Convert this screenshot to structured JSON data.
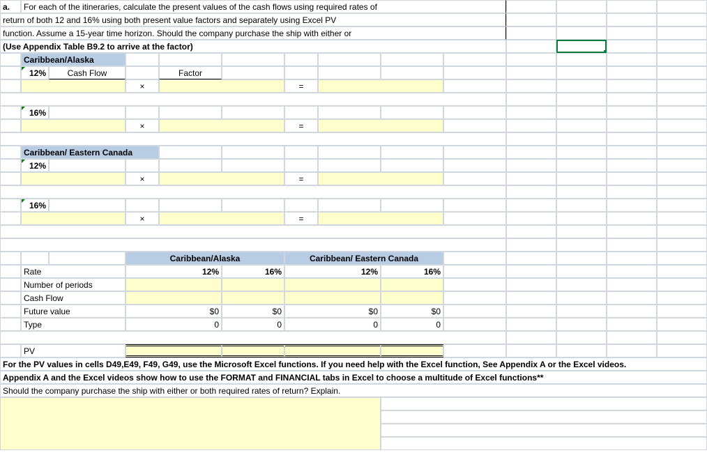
{
  "intro": {
    "line1": "a.",
    "line1b": "For each of the itineraries, calculate the present values of the cash flows using required rates of",
    "line2": "return of both 12 and 16% using both present value factors and separately using Excel PV",
    "line3": "function. Assume a 15-year time horizon. Should the company purchase the ship with either or",
    "line4": "(Use Appendix Table B9.2 to arrive at the factor)"
  },
  "sec1": {
    "title": "Caribbean/Alaska",
    "r12": "12%",
    "cashflow": "Cash Flow",
    "factor": "Factor",
    "mult": "×",
    "eq": "=",
    "r16": "16%"
  },
  "sec2": {
    "title": "Caribbean/ Eastern Canada",
    "r12": "12%",
    "r16": "16%"
  },
  "tbl": {
    "h1": "Caribbean/Alaska",
    "h2": "Caribbean/ Eastern Canada",
    "rate": "Rate",
    "p12": "12%",
    "p16": "16%",
    "nper": "Number of periods",
    "cf": "Cash Flow",
    "fv": "Future value",
    "zero_dollar": "$0",
    "type": "Type",
    "zero": "0",
    "pv": "PV"
  },
  "footer": {
    "l1": "For the PV values in cells D49,E49, F49, G49, use the Microsoft Excel functions.  If you need help with the Excel function, See Appendix A or the Excel videos.",
    "l2": "Appendix A and the Excel videos show how to use the FORMAT and FINANCIAL tabs in Excel to choose a multitude of Excel functions**",
    "l3": "Should the company purchase the ship with either or both required rates of return? Explain."
  }
}
